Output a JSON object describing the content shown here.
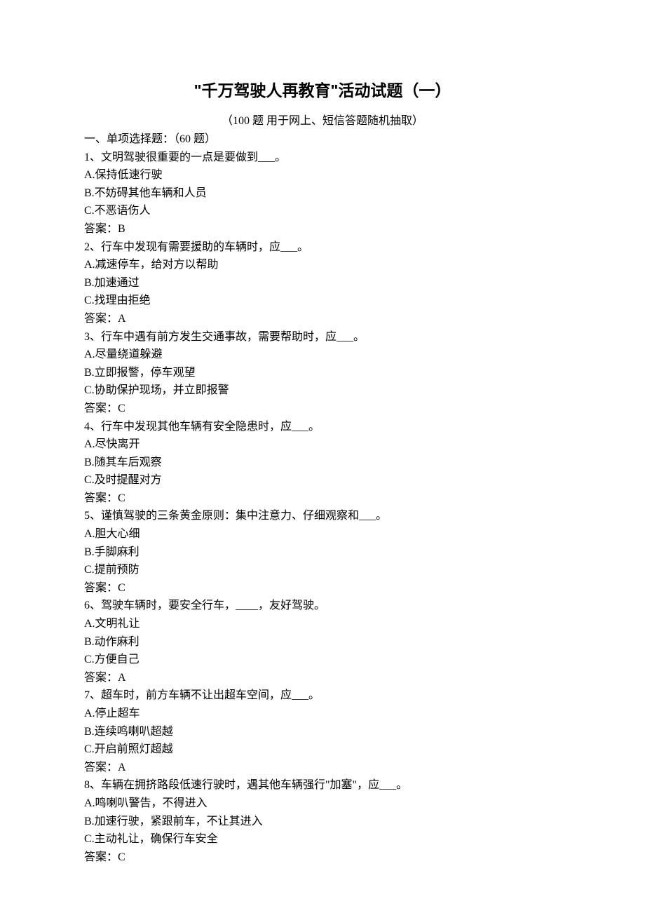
{
  "title": "\"千万驾驶人再教育\"活动试题（一）",
  "subtitle": "（100 题  用于网上、短信答题随机抽取）",
  "section_header": "一、单项选择题：（60 题）",
  "answer_prefix": "答案：",
  "blank3": "___",
  "blank4": "____",
  "questions": [
    {
      "num": "1、",
      "stem_pre": "文明驾驶很重要的一点是要做到",
      "stem_post": "。",
      "opts": [
        "A.保持低速行驶",
        "B.不妨碍其他车辆和人员",
        "C.不恶语伤人"
      ],
      "ans": "B"
    },
    {
      "num": "2、",
      "stem_pre": "行车中发现有需要援助的车辆时，应",
      "stem_post": "。",
      "opts": [
        "A.减速停车，给对方以帮助",
        "B.加速通过",
        "C.找理由拒绝"
      ],
      "ans": "A"
    },
    {
      "num": "3、",
      "stem_pre": "行车中遇有前方发生交通事故，需要帮助时，应",
      "stem_post": "。",
      "opts": [
        "A.尽量绕道躲避",
        "B.立即报警，停车观望",
        "C.协助保护现场，并立即报警"
      ],
      "ans": "C"
    },
    {
      "num": "4、",
      "stem_pre": "行车中发现其他车辆有安全隐患时，应",
      "stem_post": "。",
      "opts": [
        "A.尽快离开",
        "B.随其车后观察",
        "C.及时提醒对方"
      ],
      "ans": "C"
    },
    {
      "num": "5、",
      "stem_pre": "谨慎驾驶的三条黄金原则：集中注意力、仔细观察和",
      "stem_post": "。",
      "opts": [
        "A.胆大心细",
        "B.手脚麻利",
        "C.提前预防"
      ],
      "ans": "C"
    },
    {
      "num": "6、",
      "stem_pre": "驾驶车辆时，要安全行车，",
      "stem_post": "，友好驾驶。",
      "blank": "blank4",
      "opts": [
        "A.文明礼让",
        "B.动作麻利",
        "C.方便自己"
      ],
      "ans": "A"
    },
    {
      "num": "7、",
      "stem_pre": "超车时，前方车辆不让出超车空间，应",
      "stem_post": "。",
      "opts": [
        "A.停止超车",
        "B.连续鸣喇叭超越",
        "C.开启前照灯超越"
      ],
      "ans": "A"
    },
    {
      "num": "8、",
      "stem_pre": "车辆在拥挤路段低速行驶时，遇其他车辆强行\"加塞\"，应",
      "stem_post": "。",
      "opts": [
        "A.鸣喇叭警告，不得进入",
        "B.加速行驶，紧跟前车，不让其进入",
        "C.主动礼让，确保行车安全"
      ],
      "ans": "C"
    }
  ]
}
